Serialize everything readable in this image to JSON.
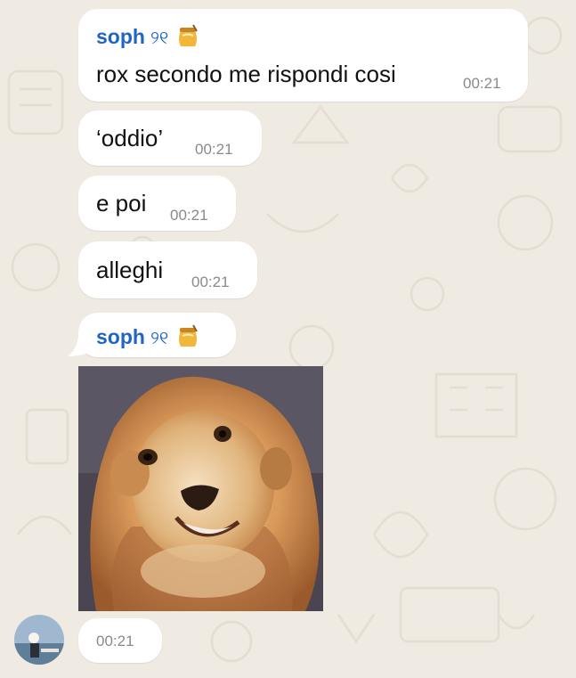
{
  "messages": [
    {
      "sender": "soph",
      "sender_deco": "୨୧",
      "text": "rox secondo me rispondi cosi",
      "time": "00:21"
    },
    {
      "text": "‘oddio’",
      "time": "00:21"
    },
    {
      "text": "e poi",
      "time": "00:21"
    },
    {
      "text": "alleghi",
      "time": "00:21"
    },
    {
      "sender": "soph",
      "sender_deco": "୨୧",
      "time": "00:21",
      "sticker": "lion-sticker"
    }
  ],
  "colors": {
    "background": "#efeae2",
    "bubble": "#ffffff",
    "sender_name": "#1f66c4",
    "timestamp": "#8a8a8a"
  }
}
